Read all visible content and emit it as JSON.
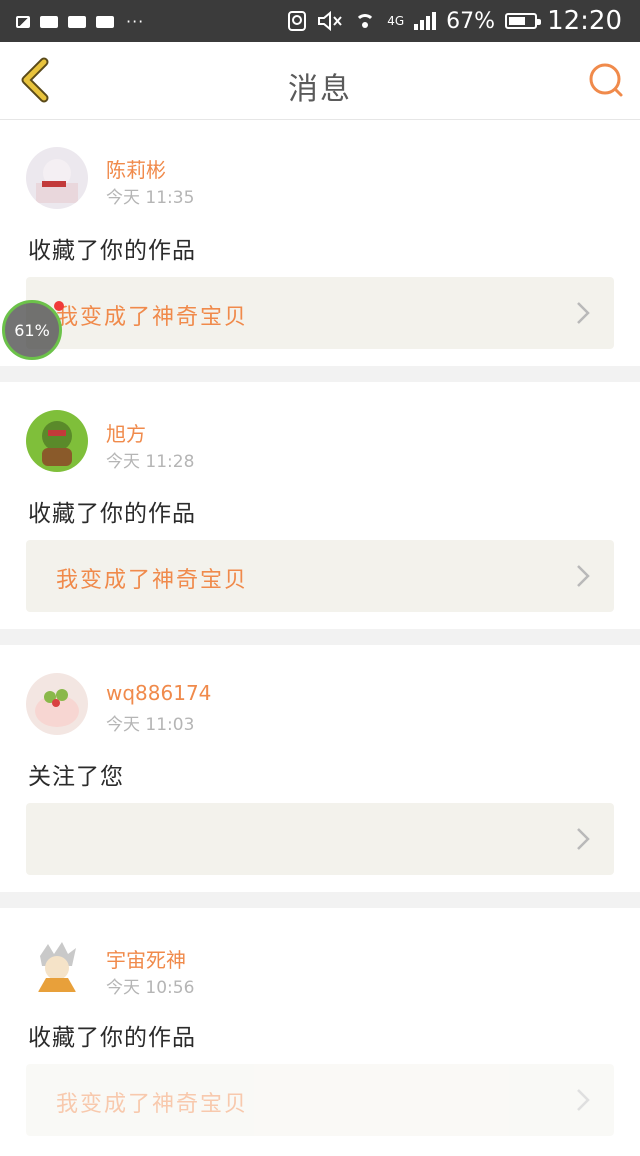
{
  "status_bar": {
    "dots": "···",
    "network": "4G",
    "battery_text": "67%",
    "battery_level": 0.67,
    "time": "12:20"
  },
  "nav": {
    "title": "消息",
    "back_icon": "chevron-left-icon",
    "search_icon": "search-icon"
  },
  "colors": {
    "accent": "#f08a4b",
    "back": "#e8c33c",
    "card_bg": "#f3f2ec",
    "separator": "#f2f2f2"
  },
  "messages": [
    {
      "username": "陈莉彬",
      "time": "今天 11:35",
      "action": "收藏了你的作品",
      "work_title": "我变成了神奇宝贝"
    },
    {
      "username": "旭方",
      "time": "今天 11:28",
      "action": "收藏了你的作品",
      "work_title": "我变成了神奇宝贝"
    },
    {
      "username": "wq886174",
      "time": "今天 11:03",
      "action": "关注了您",
      "work_title": ""
    },
    {
      "username": "宇宙死神",
      "time": "今天 10:56",
      "action": "收藏了你的作品",
      "work_title": "我变成了神奇宝贝"
    }
  ],
  "floating_badge": {
    "text": "61%"
  }
}
